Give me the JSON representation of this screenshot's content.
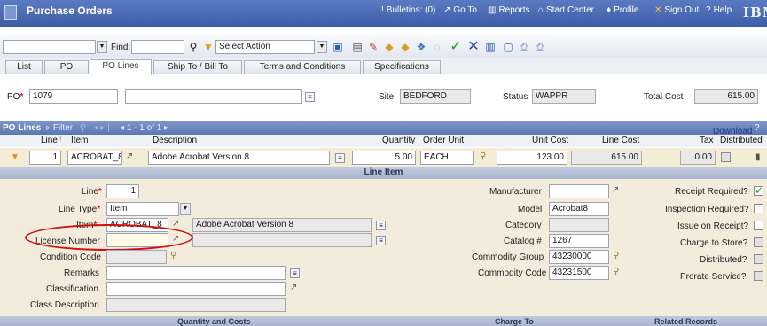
{
  "app": {
    "title": "Purchase Orders"
  },
  "toplinks": {
    "bulletins": "Bulletins: (0)",
    "goto": "Go To",
    "reports": "Reports",
    "start_center": "Start Center",
    "profile": "Profile",
    "signout": "Sign Out",
    "help": "Help",
    "logo": "IBM"
  },
  "toolbar": {
    "find_label": "Find:",
    "find_value": "",
    "action_value": "Select Action"
  },
  "tabs": [
    {
      "label": "List"
    },
    {
      "label": "PO"
    },
    {
      "label": "PO Lines"
    },
    {
      "label": "Ship To / Bill To"
    },
    {
      "label": "Terms and Conditions"
    },
    {
      "label": "Specifications"
    }
  ],
  "header": {
    "po_label": "PO",
    "po_value": "1079",
    "po_desc": "",
    "site_label": "Site",
    "site_value": "BEDFORD",
    "status_label": "Status",
    "status_value": "WAPPR",
    "total_label": "Total Cost",
    "total_value": "615.00"
  },
  "polines": {
    "title": "PO Lines",
    "filter": "Filter",
    "range": "1 - 1 of 1",
    "download": "Download",
    "columns": {
      "line": "Line",
      "item": "Item",
      "description": "Description",
      "quantity": "Quantity",
      "order_unit": "Order Unit",
      "unit_cost": "Unit Cost",
      "line_cost": "Line Cost",
      "tax": "Tax",
      "distributed": "Distributed"
    },
    "row": {
      "line": "1",
      "item": "ACROBAT_8",
      "description": "Adobe Acrobat Version 8",
      "quantity": "5.00",
      "order_unit": "EACH",
      "unit_cost": "123.00",
      "line_cost": "615.00",
      "tax": "0.00"
    }
  },
  "lineitem": {
    "title": "Line Item",
    "left": {
      "line_label": "Line",
      "line_value": "1",
      "linetype_label": "Line Type",
      "linetype_value": "Item",
      "item_label": "Item",
      "item_value": "ACROBAT_8",
      "item_desc": "Adobe Acrobat Version 8",
      "license_label": "License Number",
      "license_value": "",
      "condition_label": "Condition Code",
      "remarks_label": "Remarks",
      "classification_label": "Classification",
      "classdesc_label": "Class Description"
    },
    "middle": {
      "manufacturer_label": "Manufacturer",
      "manufacturer_value": "",
      "model_label": "Model",
      "model_value": "Acrobat8",
      "category_label": "Category",
      "category_value": "",
      "catalog_label": "Catalog #",
      "catalog_value": "1267",
      "commodity_group_label": "Commodity Group",
      "commodity_group_value": "43230000",
      "commodity_code_label": "Commodity Code",
      "commodity_code_value": "43231500"
    },
    "right": {
      "receipt_required": "Receipt Required?",
      "inspection_required": "Inspection Required?",
      "issue_on_receipt": "Issue on Receipt?",
      "charge_to_store": "Charge to Store?",
      "distributed": "Distributed?",
      "prorate_service": "Prorate Service?"
    }
  },
  "bottom": {
    "quantity_costs": "Quantity and Costs",
    "charge_to": "Charge To",
    "related_records": "Related Records"
  },
  "colors": {
    "accent": "#5b77b3",
    "required": "#d22222",
    "highlight": "#d01010"
  }
}
